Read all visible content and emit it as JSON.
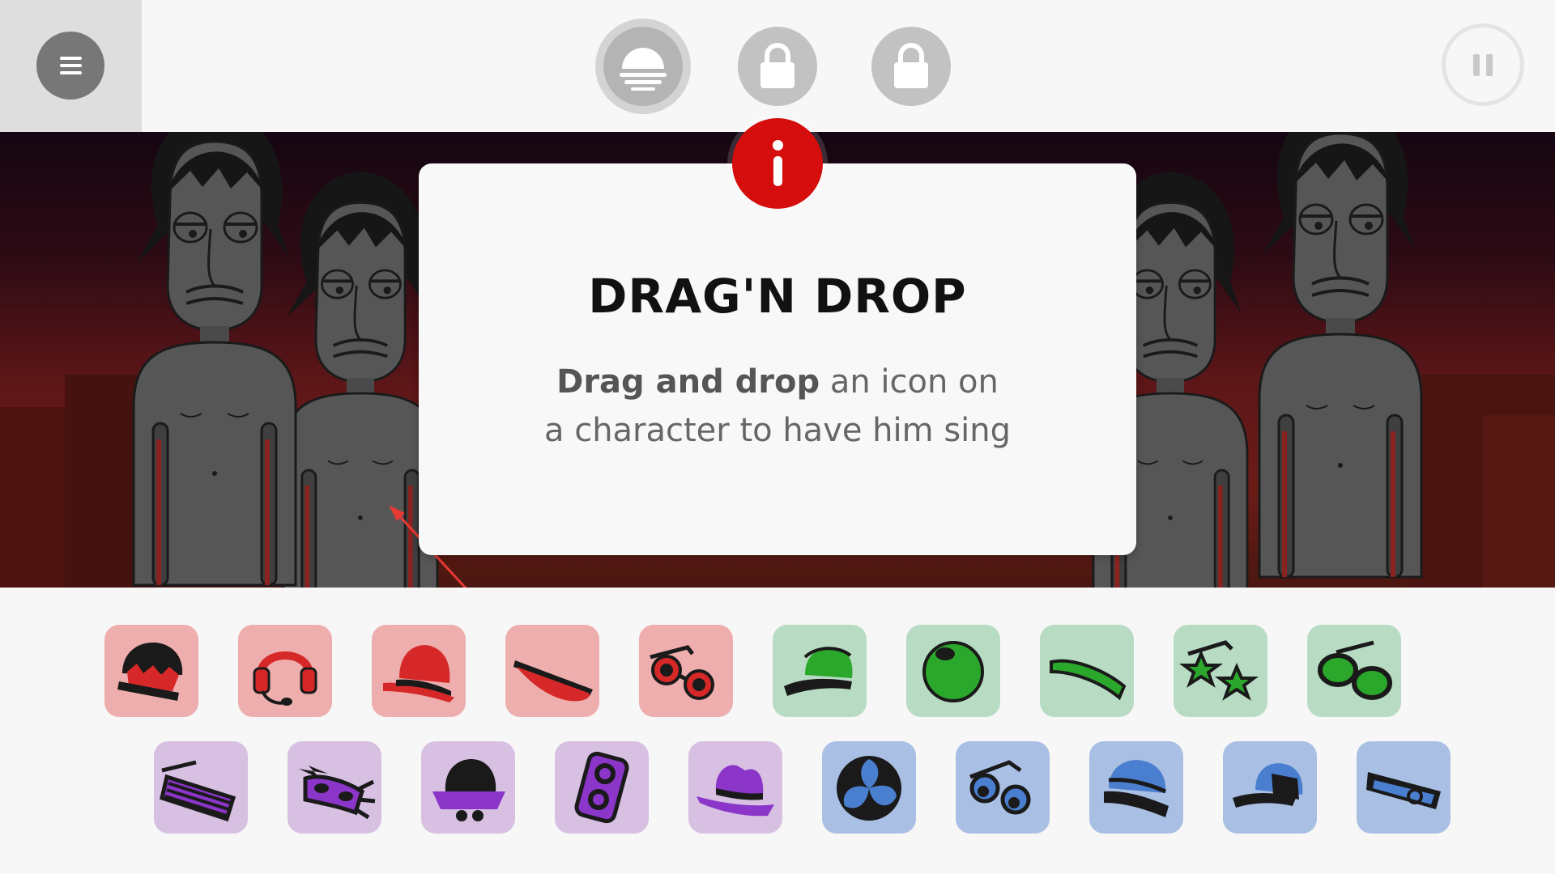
{
  "modal": {
    "title": "DRAG'N DROP",
    "body_bold": "Drag and drop",
    "body_rest_line1": " an icon on",
    "body_line2": "a character to have him sing"
  },
  "colors": {
    "info_badge": "#d50d0d",
    "tray_red": "#eeaeae",
    "tray_green": "#b7dcc3",
    "tray_purple": "#d7c0e2",
    "tray_blue": "#a9bfe3",
    "hint_arrow": "#e53935"
  },
  "top_bar": {
    "menu_icon": "hamburger-icon",
    "modes": [
      {
        "icon": "sunset-icon",
        "state": "selected"
      },
      {
        "icon": "lock-icon",
        "state": "locked"
      },
      {
        "icon": "lock-icon",
        "state": "locked"
      }
    ],
    "pause_icon": "pause-icon"
  },
  "tray": {
    "row1": [
      {
        "icon": "crown-cap-icon",
        "color": "red"
      },
      {
        "icon": "headset-icon",
        "color": "red"
      },
      {
        "icon": "hat-icon",
        "color": "red"
      },
      {
        "icon": "visor-icon",
        "color": "red"
      },
      {
        "icon": "sunglasses-icon",
        "color": "red"
      },
      {
        "icon": "cap-icon",
        "color": "green"
      },
      {
        "icon": "ball-icon",
        "color": "green"
      },
      {
        "icon": "headband-icon",
        "color": "green"
      },
      {
        "icon": "star-glasses-icon",
        "color": "green"
      },
      {
        "icon": "goggles-icon",
        "color": "green"
      }
    ],
    "row2": [
      {
        "icon": "shutter-shades-icon",
        "color": "purple"
      },
      {
        "icon": "mask-icon",
        "color": "purple"
      },
      {
        "icon": "bucket-hat-icon",
        "color": "purple"
      },
      {
        "icon": "speaker-icon",
        "color": "purple"
      },
      {
        "icon": "fedora-icon",
        "color": "purple"
      },
      {
        "icon": "swirl-icon",
        "color": "blue"
      },
      {
        "icon": "round-glasses-icon",
        "color": "blue"
      },
      {
        "icon": "beanie-icon",
        "color": "blue"
      },
      {
        "icon": "baseball-cap-icon",
        "color": "blue"
      },
      {
        "icon": "vr-visor-icon",
        "color": "blue"
      }
    ]
  }
}
